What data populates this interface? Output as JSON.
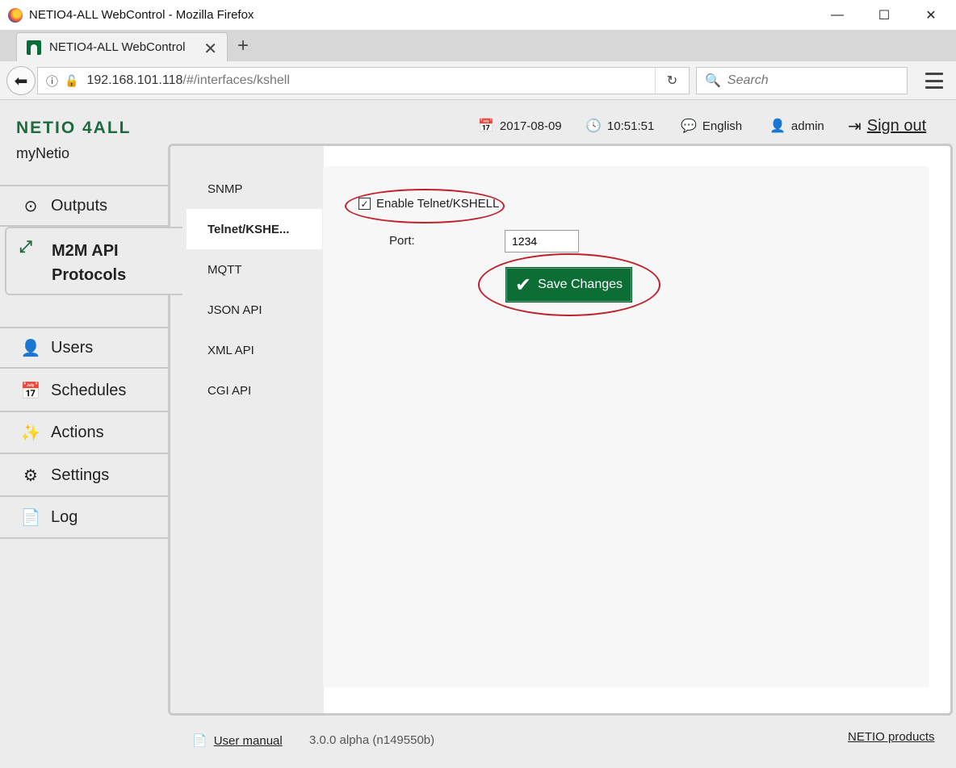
{
  "window": {
    "title": "NETIO4-ALL WebControl - Mozilla Firefox",
    "minimize": "—",
    "maximize": "☐",
    "close": "✕"
  },
  "browser": {
    "tab_title": "NETIO4-ALL WebControl",
    "url_host": "192.168.101.118",
    "url_path": "/#/interfaces/kshell",
    "search_placeholder": "Search"
  },
  "app": {
    "brand": "NETIO 4ALL",
    "device_name": "myNetio",
    "date": "2017-08-09",
    "time": "10:51:51",
    "language": "English",
    "user": "admin",
    "sign_out": "Sign out"
  },
  "sidebar": {
    "outputs": "Outputs",
    "m2m_line1": "M2M API",
    "m2m_line2": "Protocols",
    "users": "Users",
    "schedules": "Schedules",
    "actions": "Actions",
    "settings": "Settings",
    "log": "Log"
  },
  "subnav": {
    "snmp": "SNMP",
    "telnet": "Telnet/KSHE...",
    "mqtt": "MQTT",
    "json": "JSON API",
    "xml": "XML API",
    "cgi": "CGI API"
  },
  "form": {
    "enable_label": "Enable Telnet/KSHELL",
    "enabled": true,
    "port_label": "Port:",
    "port_value": "1234",
    "save_label": "Save Changes"
  },
  "footer": {
    "manual": "User manual",
    "version": "3.0.0 alpha (n149550b)",
    "products": "NETIO products"
  },
  "colors": {
    "brand_green": "#1e6a3f",
    "save_button": "#0c6e34",
    "highlight_red": "#c0202a"
  }
}
